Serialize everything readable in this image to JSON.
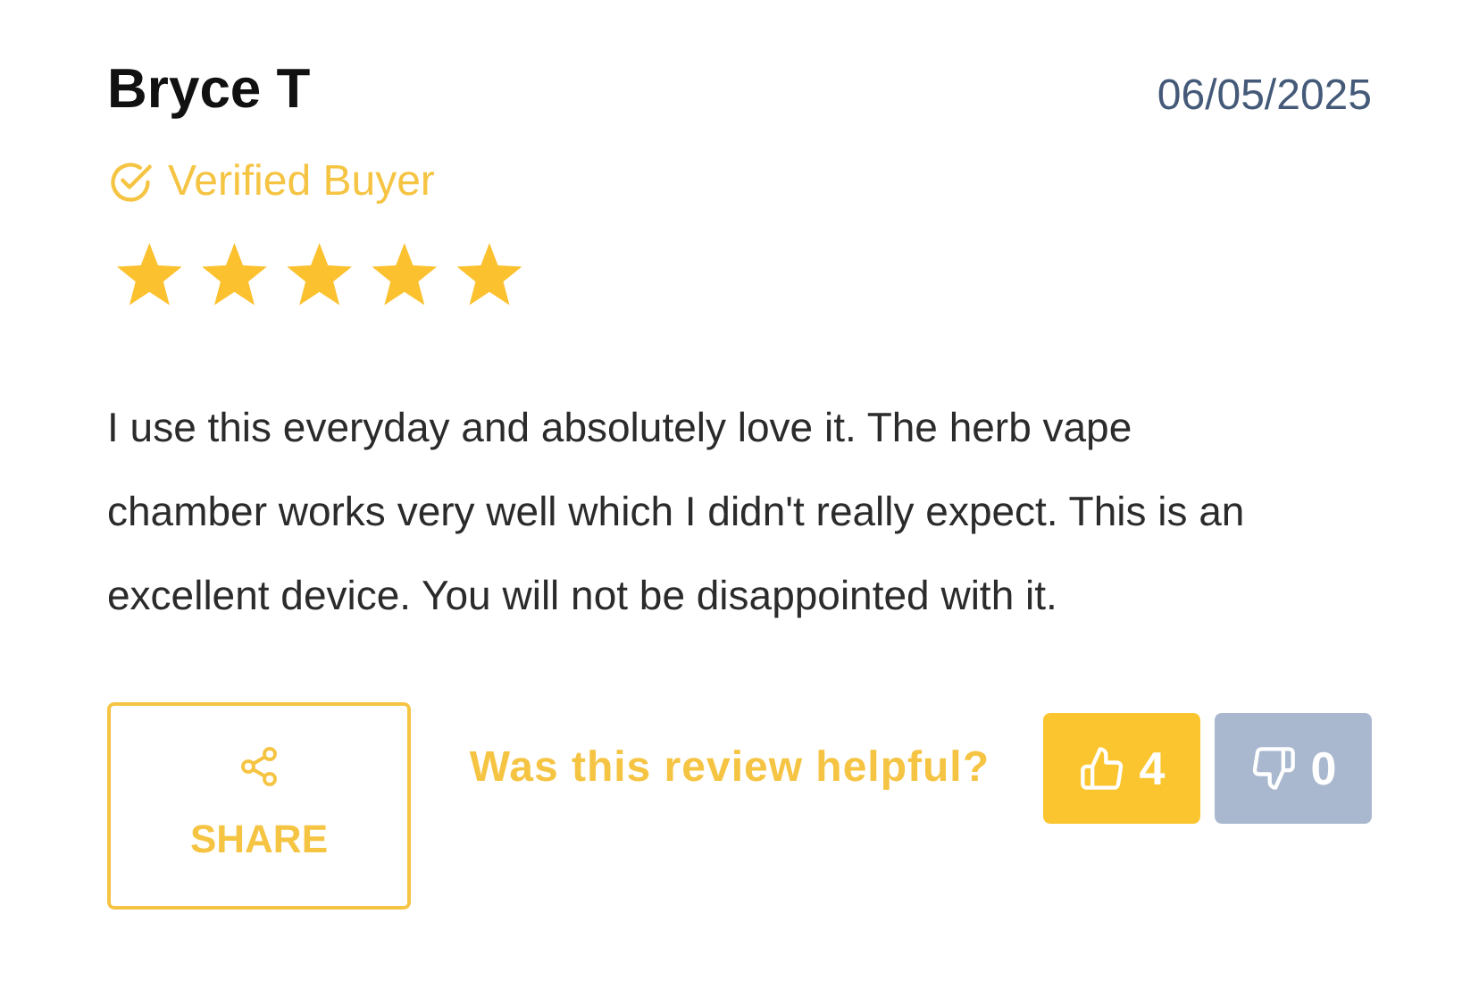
{
  "review": {
    "author": "Bryce T",
    "date": "06/05/2025",
    "verified": "Verified Buyer",
    "stars": 5,
    "text": "I use this everyday and absolutely love it. The herb vape chamber works very well which I didn't really expect. This is an excellent device. You will not be disappointed with it."
  },
  "share": {
    "label": "SHARE"
  },
  "helpful": {
    "question": "Was this review helpful?",
    "votes": [
      {
        "kind": "up",
        "count": "4"
      },
      {
        "kind": "down",
        "count": "0"
      }
    ]
  }
}
